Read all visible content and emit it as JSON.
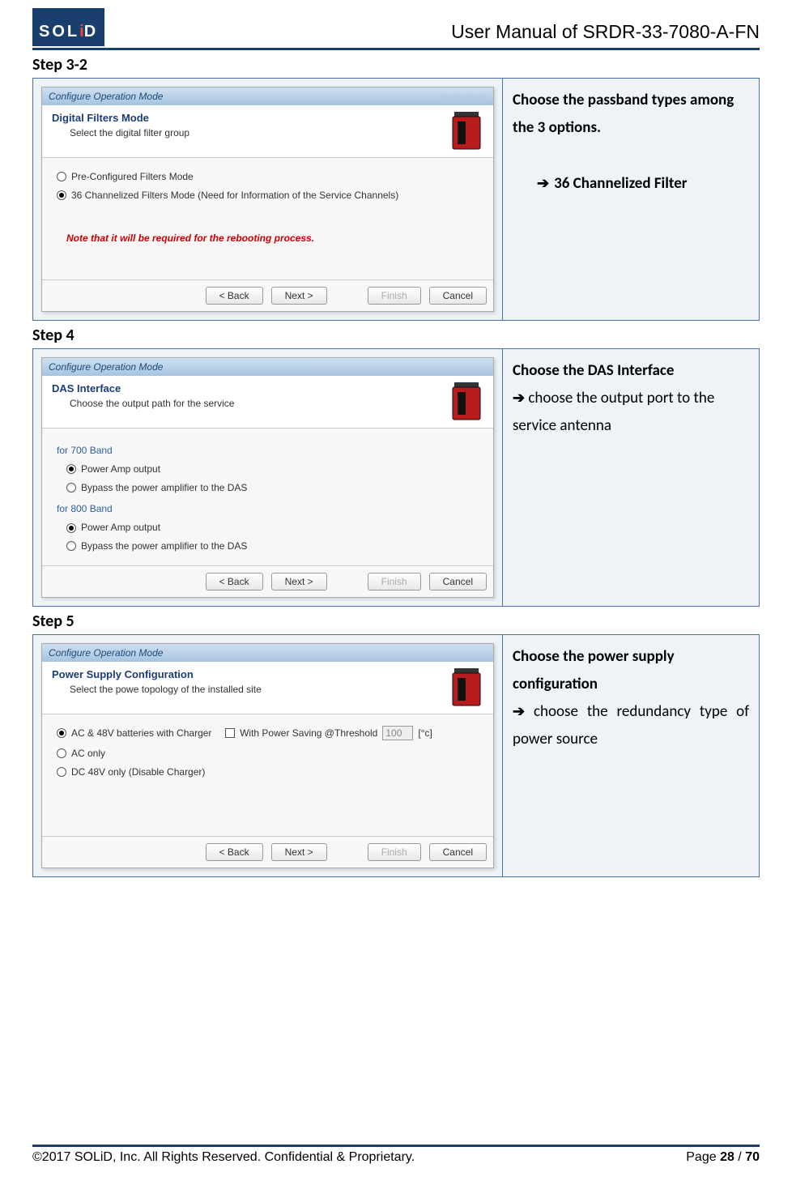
{
  "header": {
    "logo_left": "SOL",
    "logo_i": "i",
    "logo_right": "D",
    "title": "User Manual of SRDR-33-7080-A-FN"
  },
  "steps": [
    {
      "label": "Step 3-2",
      "desc_bold": "Choose the passband types among the 3 options.",
      "desc_arrow": "36 Channelized Filter",
      "wizard": {
        "titlebar": "Configure Operation Mode",
        "hdr_bold": "Digital Filters Mode",
        "hdr_sub": "Select the digital filter group",
        "options": [
          {
            "checked": false,
            "label": "Pre-Configured Filters Mode"
          },
          {
            "checked": true,
            "label": "36 Channelized Filters Mode (Need for Information of the Service Channels)"
          }
        ],
        "note": "Note that it will be required for the rebooting process."
      }
    },
    {
      "label": "Step 4",
      "desc_bold": "Choose the DAS Interface",
      "desc_plain": " choose the output port to the service antenna",
      "wizard": {
        "titlebar": "Configure Operation Mode",
        "hdr_bold": "DAS Interface",
        "hdr_sub": "Choose the output path for the service",
        "sections": [
          {
            "title": "for 700 Band",
            "options": [
              {
                "checked": true,
                "label": "Power Amp output"
              },
              {
                "checked": false,
                "label": "Bypass the power amplifier to the DAS"
              }
            ]
          },
          {
            "title": "for 800 Band",
            "options": [
              {
                "checked": true,
                "label": "Power Amp output"
              },
              {
                "checked": false,
                "label": "Bypass the power amplifier to the DAS"
              }
            ]
          }
        ]
      }
    },
    {
      "label": "Step 5",
      "desc_bold": "Choose the power supply configuration",
      "desc_plain": " choose the redundancy type of power source",
      "wizard": {
        "titlebar": "Configure Operation Mode",
        "hdr_bold": "Power Supply Configuration",
        "hdr_sub": "Select the powe topology of the installed site",
        "power_options": [
          {
            "checked": true,
            "label": "AC & 48V batteries with Charger",
            "threshold": true,
            "th_label": "With Power Saving @Threshold",
            "th_value": "100",
            "th_unit": "[°c]"
          },
          {
            "checked": false,
            "label": "AC only"
          },
          {
            "checked": false,
            "label": "DC 48V only (Disable Charger)"
          }
        ]
      }
    }
  ],
  "buttons": {
    "back": "< Back",
    "next": "Next >",
    "finish": "Finish",
    "cancel": "Cancel"
  },
  "footer": {
    "left": "©2017 SOLiD, Inc. All Rights Reserved. Confidential & Proprietary.",
    "right_prefix": "Page ",
    "page": "28",
    "sep": " / ",
    "total": "70"
  }
}
